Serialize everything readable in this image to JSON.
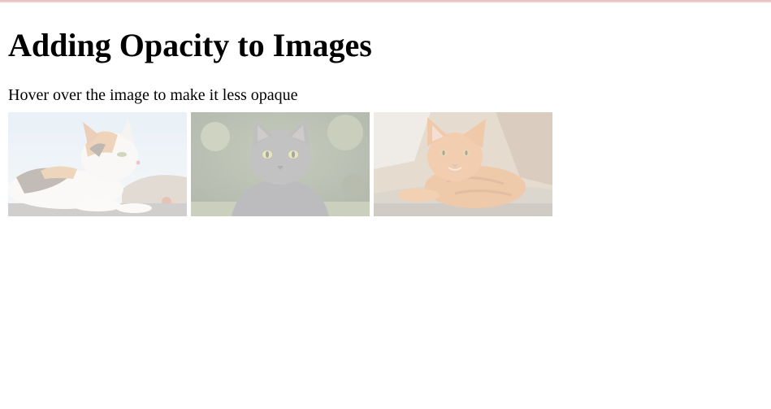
{
  "page": {
    "heading": "Adding Opacity to Images",
    "instruction": "Hover over the image to make it less opaque"
  },
  "gallery": {
    "images": [
      {
        "subject": "calico-cat-icon",
        "opacity": 0.4
      },
      {
        "subject": "gray-cat-icon",
        "opacity": 0.4
      },
      {
        "subject": "orange-cat-icon",
        "opacity": 0.4
      }
    ]
  },
  "colors": {
    "page_background": "#ffffff",
    "text": "#000000",
    "top_border": "#e8b8b8"
  }
}
